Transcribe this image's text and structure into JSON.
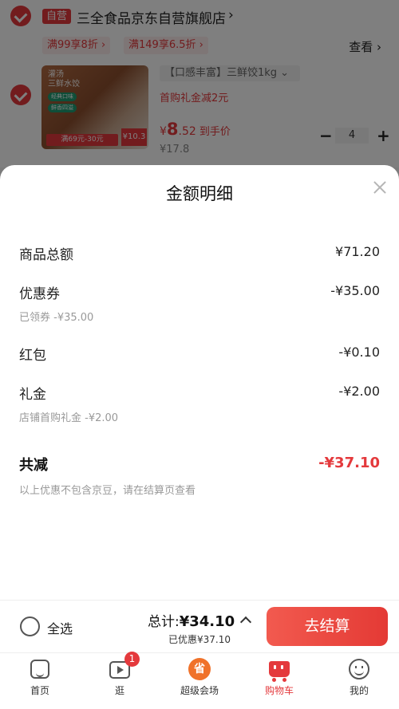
{
  "store": {
    "tag": "自营",
    "name": "三全食品京东自营旗舰店",
    "arrow": "›",
    "promos": [
      "满99享8折 ›",
      "满149享6.5折 ›"
    ],
    "see_label": "查看 ›"
  },
  "product": {
    "image_texts": {
      "line1": "灌汤",
      "line2": "三鲜水饺",
      "pill1": "经典口味",
      "pill2": "鲜香四溢",
      "bottom_tag": "满69元-30元",
      "price_tag": "¥10.3"
    },
    "spec": "【口感丰富】三鲜饺1kg ⌄",
    "gift_text": "首购礼金减2元",
    "price_yen": "¥",
    "price_int": "8",
    "price_dec": ".52",
    "price_label": "到手价",
    "original_price": "¥17.8",
    "qty_minus": "−",
    "quantity": "4",
    "qty_plus": "+"
  },
  "sheet": {
    "title": "金额明细",
    "rows": [
      {
        "label": "商品总额",
        "amount": "¥71.20",
        "sub": ""
      },
      {
        "label": "优惠券",
        "amount": "-¥35.00",
        "sub": "已领券 -¥35.00"
      },
      {
        "label": "红包",
        "amount": "-¥0.10",
        "sub": ""
      },
      {
        "label": "礼金",
        "amount": "-¥2.00",
        "sub": "店铺首购礼金 -¥2.00"
      }
    ],
    "total_label": "共减",
    "total_amount": "-¥37.10",
    "note": "以上优惠不包含京豆，请在结算页查看"
  },
  "checkout": {
    "select_all": "全选",
    "total_prefix": "总计:",
    "total_value": "¥34.10",
    "saved": "已优惠¥37.10",
    "button": "去结算"
  },
  "tabbar": {
    "items": [
      {
        "label": "首页",
        "icon": "home-icon"
      },
      {
        "label": "逛",
        "icon": "video-icon",
        "badge": "1"
      },
      {
        "label": "超级会场",
        "icon": "vip-venue-icon",
        "glyph": "省"
      },
      {
        "label": "购物车",
        "icon": "cart-icon",
        "active": true
      },
      {
        "label": "我的",
        "icon": "profile-icon"
      }
    ]
  },
  "colors": {
    "accent": "#e4393c",
    "overlay": "rgba(0,0,0,0.5)",
    "button_gradient_start": "#f25a4f",
    "button_gradient_end": "#e43a35"
  }
}
